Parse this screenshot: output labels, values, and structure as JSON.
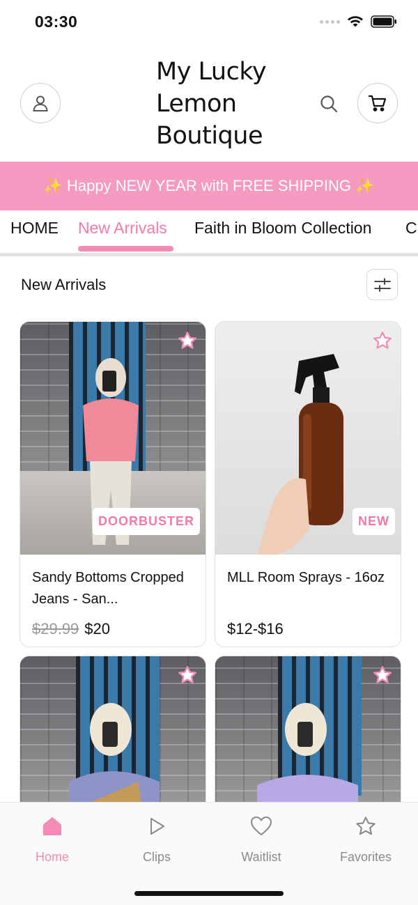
{
  "status_bar": {
    "time": "03:30"
  },
  "header": {
    "brand_line1": "My Lucky",
    "brand_line2": "Lemon",
    "brand_line3": "Boutique"
  },
  "promo": {
    "text": "✨ Happy NEW YEAR with FREE SHIPPING ✨"
  },
  "tabs": [
    {
      "label": "HOME",
      "active": false
    },
    {
      "label": "New Arrivals",
      "active": true
    },
    {
      "label": "Faith in Bloom Collection",
      "active": false
    },
    {
      "label": "C",
      "active": false
    }
  ],
  "section": {
    "title": "New Arrivals"
  },
  "products": [
    {
      "name": "Sandy Bottoms Cropped Jeans - San...",
      "old_price": "$29.99",
      "price": "$20",
      "badge": "DOORBUSTER"
    },
    {
      "name": "MLL Room Sprays - 16oz",
      "old_price": "",
      "price": "$12-$16",
      "badge": "NEW"
    },
    {
      "name": "",
      "old_price": "",
      "price": "",
      "badge": ""
    },
    {
      "name": "",
      "old_price": "",
      "price": "",
      "badge": ""
    }
  ],
  "bottom_nav": [
    {
      "label": "Home",
      "icon": "home-icon",
      "active": true
    },
    {
      "label": "Clips",
      "icon": "play-icon",
      "active": false
    },
    {
      "label": "Waitlist",
      "icon": "heart-icon",
      "active": false
    },
    {
      "label": "Favorites",
      "icon": "star-icon",
      "active": false
    }
  ],
  "colors": {
    "accent": "#f58bb6",
    "banner": "#f59ac0",
    "accent_text": "#f27aab"
  }
}
